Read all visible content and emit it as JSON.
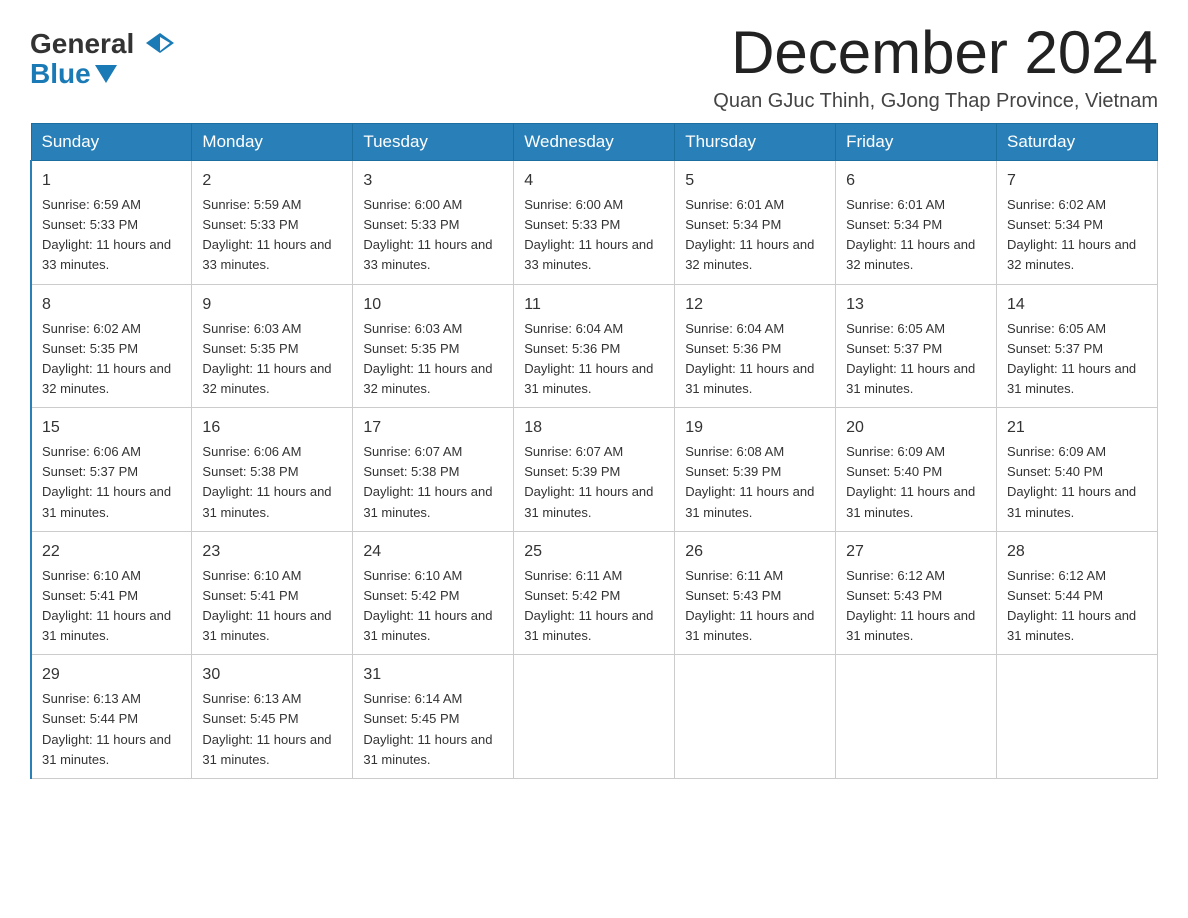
{
  "header": {
    "logo_general": "General",
    "logo_blue": "Blue",
    "month_title": "December 2024",
    "subtitle": "Quan GJuc Thinh, GJong Thap Province, Vietnam"
  },
  "days_of_week": [
    "Sunday",
    "Monday",
    "Tuesday",
    "Wednesday",
    "Thursday",
    "Friday",
    "Saturday"
  ],
  "weeks": [
    [
      {
        "day": 1,
        "sunrise": "6:59 AM",
        "sunset": "5:33 PM",
        "daylight": "11 hours and 33 minutes."
      },
      {
        "day": 2,
        "sunrise": "5:59 AM",
        "sunset": "5:33 PM",
        "daylight": "11 hours and 33 minutes."
      },
      {
        "day": 3,
        "sunrise": "6:00 AM",
        "sunset": "5:33 PM",
        "daylight": "11 hours and 33 minutes."
      },
      {
        "day": 4,
        "sunrise": "6:00 AM",
        "sunset": "5:33 PM",
        "daylight": "11 hours and 33 minutes."
      },
      {
        "day": 5,
        "sunrise": "6:01 AM",
        "sunset": "5:34 PM",
        "daylight": "11 hours and 32 minutes."
      },
      {
        "day": 6,
        "sunrise": "6:01 AM",
        "sunset": "5:34 PM",
        "daylight": "11 hours and 32 minutes."
      },
      {
        "day": 7,
        "sunrise": "6:02 AM",
        "sunset": "5:34 PM",
        "daylight": "11 hours and 32 minutes."
      }
    ],
    [
      {
        "day": 8,
        "sunrise": "6:02 AM",
        "sunset": "5:35 PM",
        "daylight": "11 hours and 32 minutes."
      },
      {
        "day": 9,
        "sunrise": "6:03 AM",
        "sunset": "5:35 PM",
        "daylight": "11 hours and 32 minutes."
      },
      {
        "day": 10,
        "sunrise": "6:03 AM",
        "sunset": "5:35 PM",
        "daylight": "11 hours and 32 minutes."
      },
      {
        "day": 11,
        "sunrise": "6:04 AM",
        "sunset": "5:36 PM",
        "daylight": "11 hours and 31 minutes."
      },
      {
        "day": 12,
        "sunrise": "6:04 AM",
        "sunset": "5:36 PM",
        "daylight": "11 hours and 31 minutes."
      },
      {
        "day": 13,
        "sunrise": "6:05 AM",
        "sunset": "5:37 PM",
        "daylight": "11 hours and 31 minutes."
      },
      {
        "day": 14,
        "sunrise": "6:05 AM",
        "sunset": "5:37 PM",
        "daylight": "11 hours and 31 minutes."
      }
    ],
    [
      {
        "day": 15,
        "sunrise": "6:06 AM",
        "sunset": "5:37 PM",
        "daylight": "11 hours and 31 minutes."
      },
      {
        "day": 16,
        "sunrise": "6:06 AM",
        "sunset": "5:38 PM",
        "daylight": "11 hours and 31 minutes."
      },
      {
        "day": 17,
        "sunrise": "6:07 AM",
        "sunset": "5:38 PM",
        "daylight": "11 hours and 31 minutes."
      },
      {
        "day": 18,
        "sunrise": "6:07 AM",
        "sunset": "5:39 PM",
        "daylight": "11 hours and 31 minutes."
      },
      {
        "day": 19,
        "sunrise": "6:08 AM",
        "sunset": "5:39 PM",
        "daylight": "11 hours and 31 minutes."
      },
      {
        "day": 20,
        "sunrise": "6:09 AM",
        "sunset": "5:40 PM",
        "daylight": "11 hours and 31 minutes."
      },
      {
        "day": 21,
        "sunrise": "6:09 AM",
        "sunset": "5:40 PM",
        "daylight": "11 hours and 31 minutes."
      }
    ],
    [
      {
        "day": 22,
        "sunrise": "6:10 AM",
        "sunset": "5:41 PM",
        "daylight": "11 hours and 31 minutes."
      },
      {
        "day": 23,
        "sunrise": "6:10 AM",
        "sunset": "5:41 PM",
        "daylight": "11 hours and 31 minutes."
      },
      {
        "day": 24,
        "sunrise": "6:10 AM",
        "sunset": "5:42 PM",
        "daylight": "11 hours and 31 minutes."
      },
      {
        "day": 25,
        "sunrise": "6:11 AM",
        "sunset": "5:42 PM",
        "daylight": "11 hours and 31 minutes."
      },
      {
        "day": 26,
        "sunrise": "6:11 AM",
        "sunset": "5:43 PM",
        "daylight": "11 hours and 31 minutes."
      },
      {
        "day": 27,
        "sunrise": "6:12 AM",
        "sunset": "5:43 PM",
        "daylight": "11 hours and 31 minutes."
      },
      {
        "day": 28,
        "sunrise": "6:12 AM",
        "sunset": "5:44 PM",
        "daylight": "11 hours and 31 minutes."
      }
    ],
    [
      {
        "day": 29,
        "sunrise": "6:13 AM",
        "sunset": "5:44 PM",
        "daylight": "11 hours and 31 minutes."
      },
      {
        "day": 30,
        "sunrise": "6:13 AM",
        "sunset": "5:45 PM",
        "daylight": "11 hours and 31 minutes."
      },
      {
        "day": 31,
        "sunrise": "6:14 AM",
        "sunset": "5:45 PM",
        "daylight": "11 hours and 31 minutes."
      },
      null,
      null,
      null,
      null
    ]
  ]
}
